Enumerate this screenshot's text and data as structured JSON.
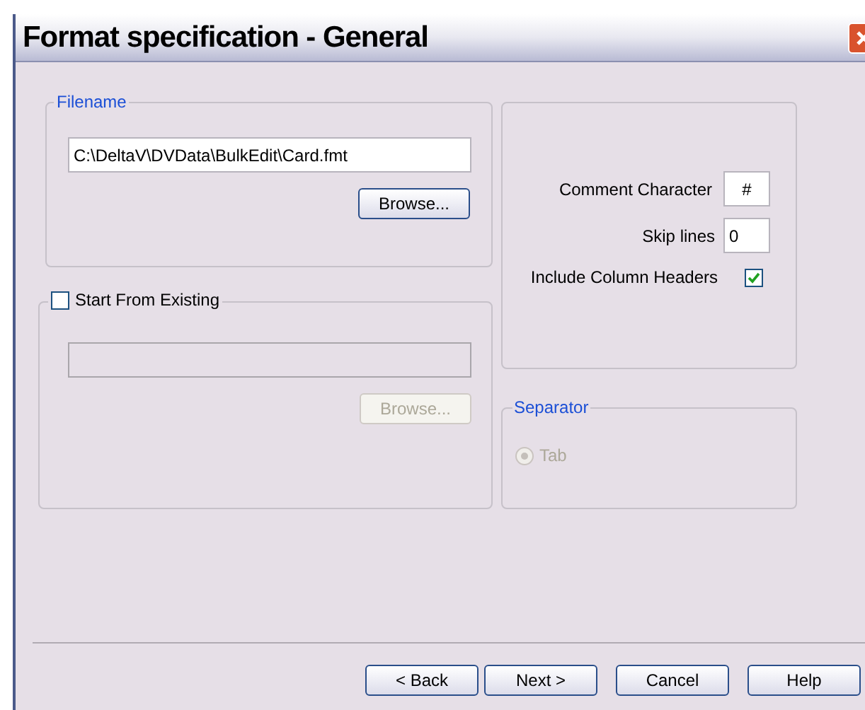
{
  "window": {
    "title": "Format specification - General"
  },
  "filename_group": {
    "legend": "Filename",
    "value": "C:\\DeltaV\\DVData\\BulkEdit\\Card.fmt",
    "browse": {
      "label": "Browse...",
      "disabled": false
    }
  },
  "start_from_existing": {
    "label": "Start From Existing",
    "checked": false,
    "field_disabled": true,
    "browse": {
      "label": "Browse...",
      "disabled": true
    }
  },
  "options": {
    "comment_character": {
      "label": "Comment Character",
      "value": "#"
    },
    "skip_lines": {
      "label": "Skip lines",
      "value": "0"
    },
    "include_column_headers": {
      "label": "Include Column Headers",
      "checked": true
    }
  },
  "separator": {
    "legend": "Separator",
    "options": [
      {
        "label": "Tab",
        "selected": true,
        "disabled": true
      }
    ]
  },
  "buttons": [
    {
      "label": "< Back"
    },
    {
      "label": "Next >"
    },
    {
      "label": "Cancel"
    },
    {
      "label": "Help"
    }
  ]
}
